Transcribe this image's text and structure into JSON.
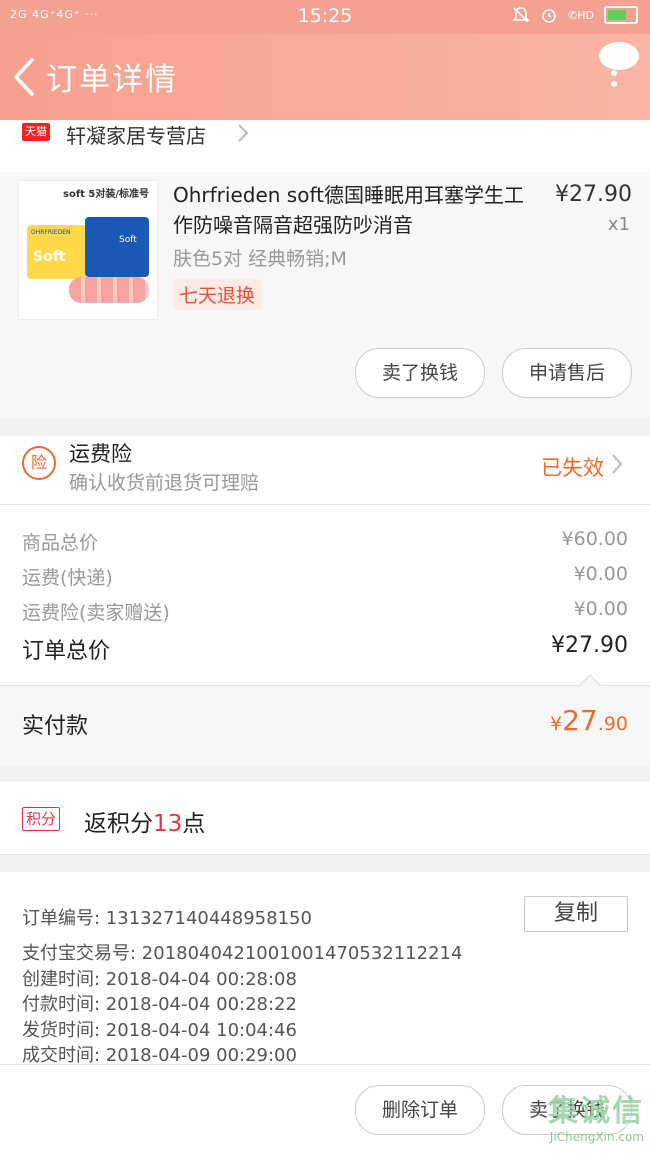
{
  "status_bar": {
    "left": "2G 4G⁺4G⁺ ···",
    "time": "15:25",
    "right_icons": [
      "bell-icon",
      "alarm-icon",
      "hd-call-icon",
      "battery-icon"
    ],
    "hd_label": "HD"
  },
  "header": {
    "title": "订单详情",
    "bg_color": "#f6a08f"
  },
  "shop": {
    "badge": "天猫",
    "name": "轩凝家居专营店"
  },
  "product": {
    "image_caption": "soft 5对装/标准号",
    "image_brand": "OHRFRIEDEN",
    "image_word": "Soft",
    "title": "Ohrfrieden soft德国睡眠用耳塞学生工作防噪音隔音超强防吵消音",
    "price": "¥27.90",
    "qty": "x1",
    "sku": "肤色5对  经典畅销;M",
    "return_tag": "七天退换",
    "buttons": [
      "卖了换钱",
      "申请售后"
    ]
  },
  "insurance": {
    "icon_char": "险",
    "title": "运费险",
    "subtitle": "确认收货前退货可理赔",
    "status": "已失效",
    "accent": "#f06a2a"
  },
  "summary": {
    "rows": [
      {
        "label": "商品总价",
        "value": "¥60.00"
      },
      {
        "label": "运费(快递)",
        "value": "¥0.00"
      },
      {
        "label": "运费险(卖家赠送)",
        "value": "¥0.00"
      }
    ],
    "total_label": "订单总价",
    "total_value": "¥27.90"
  },
  "paid": {
    "label": "实付款",
    "currency": "¥",
    "int": "27",
    "dec": ".90"
  },
  "points": {
    "badge": "积分",
    "prefix": "返积分",
    "num": "13",
    "suffix": "点"
  },
  "order_info": {
    "copy_label": "复制",
    "rows": [
      "订单编号:   131327140448958150",
      "支付宝交易号:   2018040421001001470532112214",
      "创建时间:   2018-04-04  00:28:08",
      "付款时间:   2018-04-04  00:28:22",
      "发货时间:   2018-04-04  10:04:46",
      "成交时间:   2018-04-09  00:29:00"
    ]
  },
  "footer": {
    "buttons": [
      "删除订单",
      "卖了换钱"
    ]
  },
  "watermark": {
    "text": "集诚信",
    "url": "JiChengXin.com"
  }
}
